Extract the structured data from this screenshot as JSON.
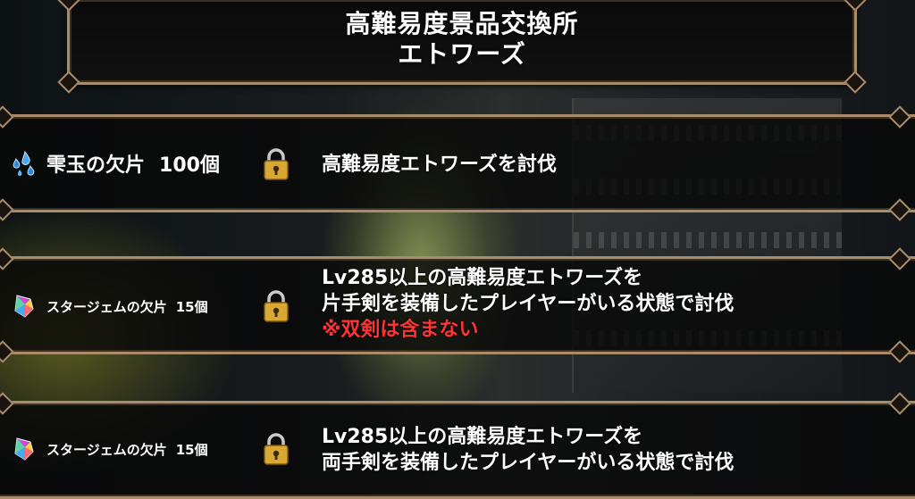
{
  "header": {
    "title_line1": "高難易度景品交換所",
    "title_line2": "エトワーズ"
  },
  "rewards": [
    {
      "item_icon": "droplet-shard-icon",
      "item_name": "雫玉の欠片",
      "item_qty": "100個",
      "locked": true,
      "condition_line1": "高難易度エトワーズを討伐",
      "condition_line2": "",
      "condition_note": ""
    },
    {
      "item_icon": "star-gem-shard-icon",
      "item_name": "スタージェムの欠片",
      "item_qty": "15個",
      "locked": true,
      "condition_line1": "Lv285以上の高難易度エトワーズを",
      "condition_line2": "片手剣を装備したプレイヤーがいる状態で討伐",
      "condition_note": "※双剣は含まない"
    },
    {
      "item_icon": "star-gem-shard-icon",
      "item_name": "スタージェムの欠片",
      "item_qty": "15個",
      "locked": true,
      "condition_line1": "Lv285以上の高難易度エトワーズを",
      "condition_line2": "両手剣を装備したプレイヤーがいる状態で討伐",
      "condition_note": ""
    }
  ],
  "colors": {
    "frame_gold": "#a98c6a",
    "note_red": "#ff3434",
    "lock_gold": "#d8a832"
  }
}
